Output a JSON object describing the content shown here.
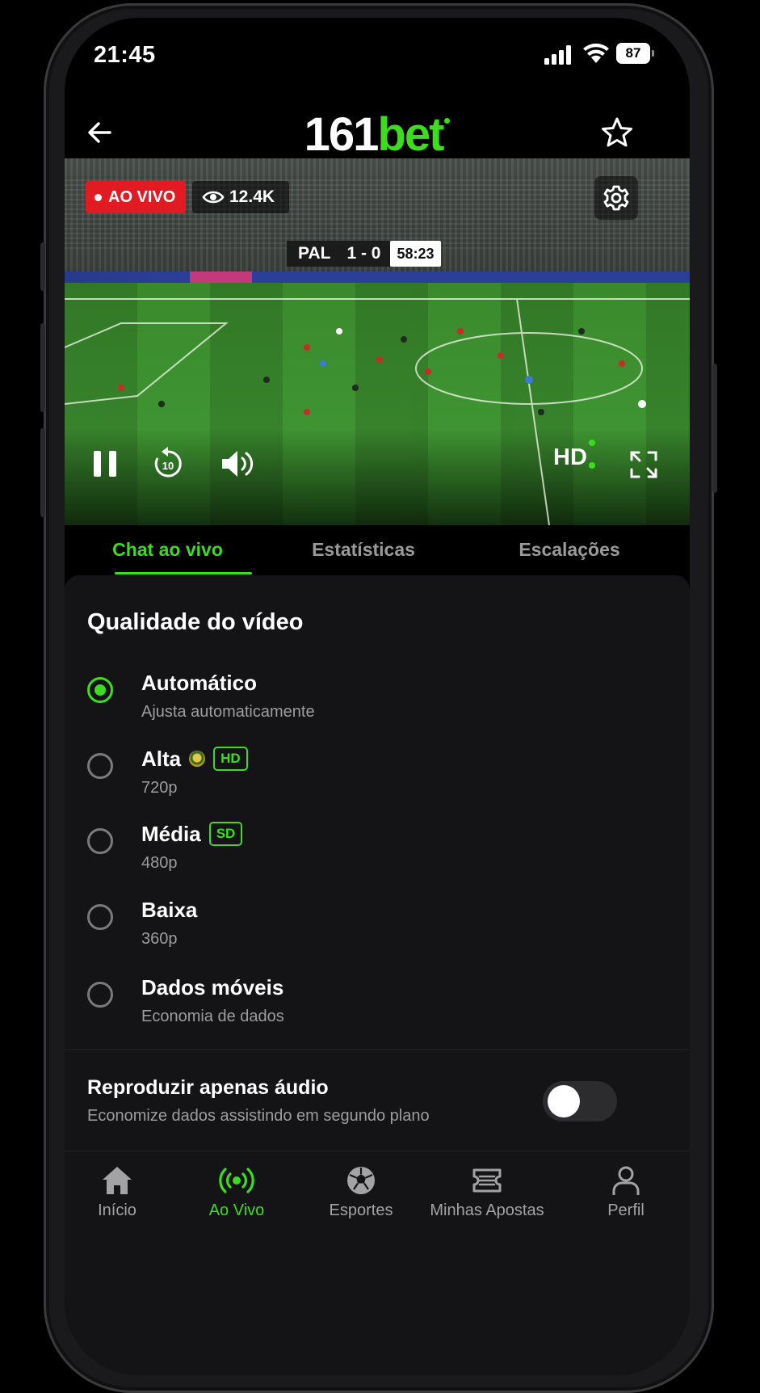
{
  "status_bar": {
    "time": "21:45",
    "battery": "87"
  },
  "app_bar": {
    "logo_part1": "161",
    "logo_part2": "bet"
  },
  "video": {
    "live_badge": "AO VIVO",
    "viewers": "12.4K",
    "scorebug": {
      "home_team": "PAL",
      "score": "1 - 0",
      "clock": "58:23"
    },
    "quality_label": "HD"
  },
  "tabs": [
    {
      "label": "Chat ao vivo",
      "active": true
    },
    {
      "label": "Estatísticas",
      "active": false
    },
    {
      "label": "Escalações",
      "active": false
    }
  ],
  "quality_sheet": {
    "title": "Qualidade do vídeo",
    "options": [
      {
        "label": "Automático",
        "sub": "Ajusta automaticamente",
        "selected": true,
        "tag": ""
      },
      {
        "label": "Alta",
        "sub": "720p",
        "selected": false,
        "tag": "HD"
      },
      {
        "label": "Média",
        "sub": "480p",
        "selected": false,
        "tag": "SD"
      },
      {
        "label": "Baixa",
        "sub": "360p",
        "selected": false,
        "tag": ""
      },
      {
        "label": "Dados móveis",
        "sub": "Economia de dados",
        "selected": false,
        "tag": ""
      }
    ],
    "audio_only": {
      "title": "Reproduzir apenas áudio",
      "sub": "Economize dados assistindo em segundo plano",
      "enabled": false
    }
  },
  "bottom_nav": [
    {
      "label": "Início",
      "icon": "home-icon",
      "active": false
    },
    {
      "label": "Ao Vivo",
      "icon": "broadcast-icon",
      "active": true
    },
    {
      "label": "Esportes",
      "icon": "soccer-ball-icon",
      "active": false
    },
    {
      "label": "Minhas Apostas",
      "icon": "ticket-icon",
      "active": false
    },
    {
      "label": "Perfil",
      "icon": "user-icon",
      "active": false
    }
  ],
  "colors": {
    "accent": "#3cdc1e",
    "live_red": "#e21b23",
    "sheet_bg": "#141416",
    "muted_text": "#9d9d9f"
  }
}
